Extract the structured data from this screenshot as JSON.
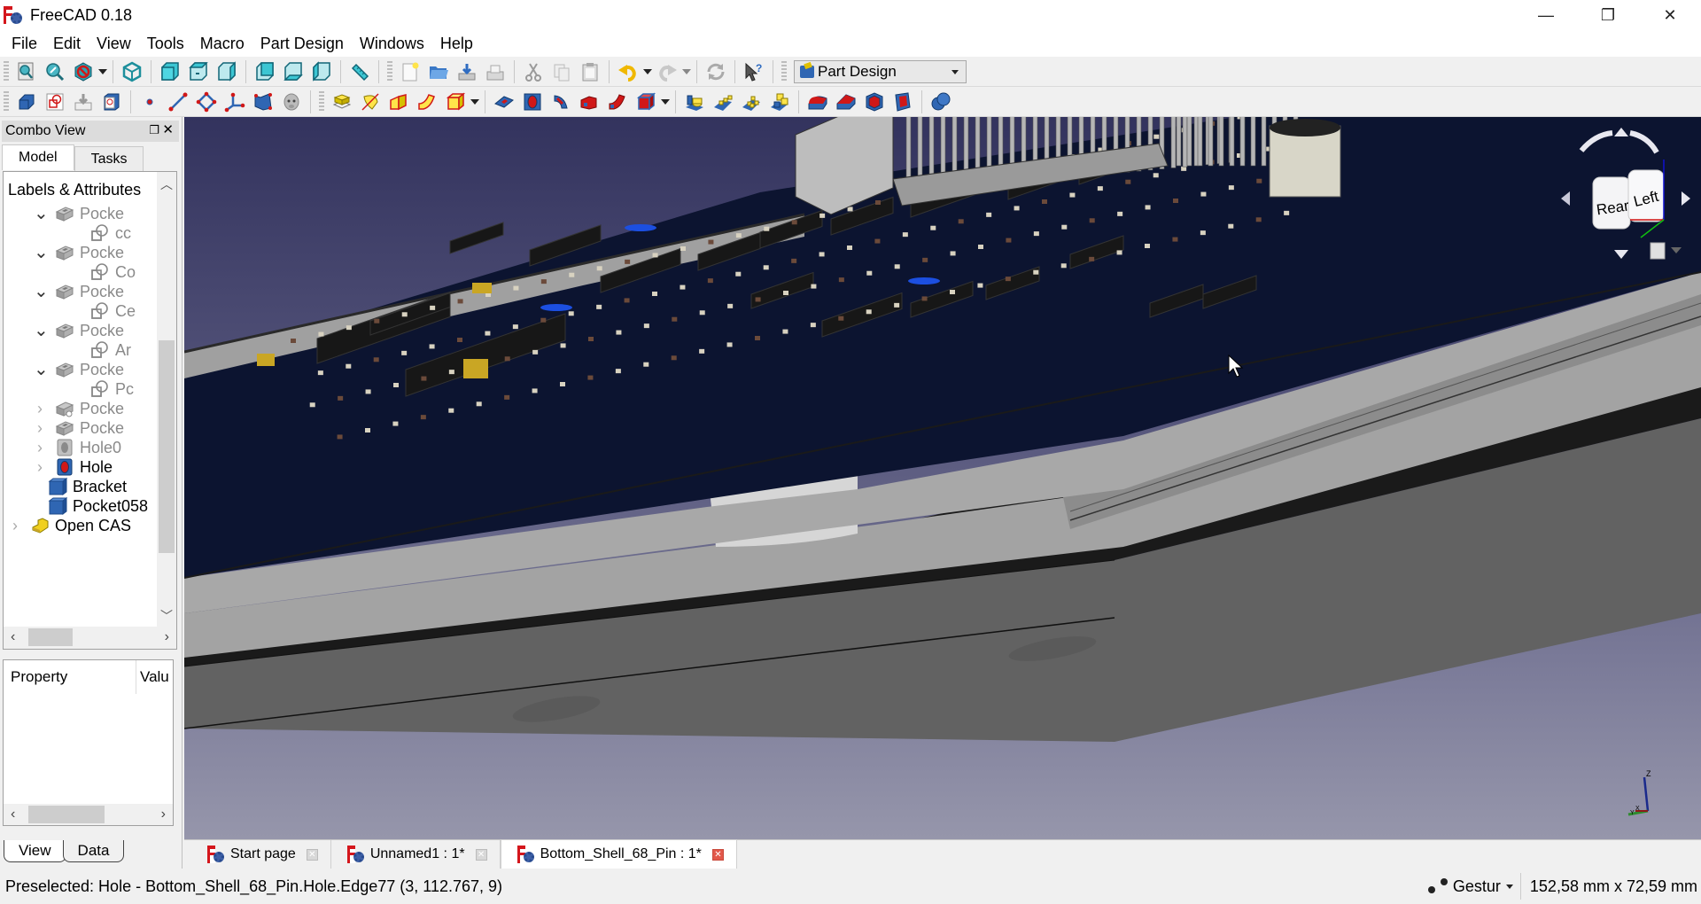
{
  "window": {
    "title": "FreeCAD 0.18",
    "controls": {
      "minimize": "—",
      "restore": "❐",
      "close": "✕"
    }
  },
  "menu": [
    "File",
    "Edit",
    "View",
    "Tools",
    "Macro",
    "Part Design",
    "Windows",
    "Help"
  ],
  "toolbar": {
    "row1": [
      {
        "name": "fit-all-icon",
        "group": "view"
      },
      {
        "name": "fit-selection-icon",
        "group": "view"
      },
      {
        "name": "draw-style-icon",
        "group": "view",
        "dropdown": true
      },
      {
        "name": "isometric-view-icon",
        "group": "std-views"
      },
      {
        "name": "front-view-icon",
        "group": "std-views"
      },
      {
        "name": "top-view-icon",
        "group": "std-views"
      },
      {
        "name": "right-view-icon",
        "group": "std-views"
      },
      {
        "name": "rear-view-icon",
        "group": "std-views2"
      },
      {
        "name": "bottom-view-icon",
        "group": "std-views2"
      },
      {
        "name": "left-view-icon",
        "group": "std-views2"
      },
      {
        "name": "measure-distance-icon",
        "group": "measure"
      },
      {
        "name": "new-document-icon",
        "group": "file"
      },
      {
        "name": "open-document-icon",
        "group": "file"
      },
      {
        "name": "save-document-icon",
        "group": "file"
      },
      {
        "name": "print-icon",
        "group": "file"
      },
      {
        "name": "cut-icon",
        "group": "edit"
      },
      {
        "name": "copy-icon",
        "group": "edit"
      },
      {
        "name": "paste-icon",
        "group": "edit"
      },
      {
        "name": "undo-icon",
        "group": "edit",
        "dropdown": true
      },
      {
        "name": "redo-icon",
        "group": "edit",
        "dropdown": true
      },
      {
        "name": "refresh-icon",
        "group": "edit"
      },
      {
        "name": "whats-this-icon",
        "group": "help"
      }
    ],
    "workbench": {
      "selected": "Part Design"
    },
    "row2": [
      "create-body-icon",
      "create-sketch-icon",
      "validate-sketch-icon",
      "shape-binder-icon",
      "datum-point-icon",
      "datum-line-icon",
      "datum-plane-icon",
      "local-coordinate-system-icon",
      "subshape-binder-icon",
      "clone-icon",
      "pad-icon",
      "revolution-icon",
      "additive-loft-icon",
      "additive-pipe-icon",
      "additive-primitive-icon",
      "pocket-icon",
      "hole-icon",
      "groove-icon",
      "subtractive-loft-icon",
      "subtractive-pipe-icon",
      "subtractive-primitive-icon",
      "mirrored-icon",
      "linear-pattern-icon",
      "polar-pattern-icon",
      "multi-transform-icon",
      "fillet-icon",
      "chamfer-icon",
      "draft-icon",
      "thickness-icon",
      "boolean-icon"
    ]
  },
  "combo_view": {
    "title": "Combo View",
    "tabs": [
      "Model",
      "Tasks"
    ],
    "active_tab": "Model",
    "tree_header": "Labels & Attributes",
    "tree": [
      {
        "label": "Pocke",
        "indent": 2,
        "expander": "down",
        "icon": "pocket-gray",
        "dim": true
      },
      {
        "label": "cc",
        "indent": 3,
        "icon": "sketch-gray",
        "dim": true
      },
      {
        "label": "Pocke",
        "indent": 2,
        "expander": "down",
        "icon": "pocket-gray",
        "dim": true
      },
      {
        "label": "Co",
        "indent": 3,
        "icon": "sketch-gray",
        "dim": true
      },
      {
        "label": "Pocke",
        "indent": 2,
        "expander": "down",
        "icon": "pocket-gray",
        "dim": true
      },
      {
        "label": "Ce",
        "indent": 3,
        "icon": "sketch-gray",
        "dim": true
      },
      {
        "label": "Pocke",
        "indent": 2,
        "expander": "down",
        "icon": "pocket-gray",
        "dim": true
      },
      {
        "label": "Ar",
        "indent": 3,
        "icon": "sketch-gray",
        "dim": true
      },
      {
        "label": "Pocke",
        "indent": 2,
        "expander": "down",
        "icon": "pocket-gray",
        "dim": true
      },
      {
        "label": "Pc",
        "indent": 3,
        "icon": "sketch-gray",
        "dim": true
      },
      {
        "label": "Pocke",
        "indent": 2,
        "expander": "right",
        "icon": "pocket-gray-link",
        "dim": true
      },
      {
        "label": "Pocke",
        "indent": 2,
        "expander": "right",
        "icon": "pocket-gray",
        "dim": true
      },
      {
        "label": "Hole0",
        "indent": 2,
        "expander": "right",
        "icon": "hole-gray",
        "dim": true
      },
      {
        "label": "Hole",
        "indent": 2,
        "expander": "right",
        "icon": "hole-color",
        "dim": false
      },
      {
        "label": "Bracket",
        "indent": 1,
        "icon": "solid-blue",
        "dim": false
      },
      {
        "label": "Pocket058",
        "indent": 1,
        "icon": "solid-blue",
        "dim": false
      },
      {
        "label": "Open CAS",
        "indent": 0,
        "expander": "right",
        "icon": "part-yellow",
        "dim": false
      }
    ],
    "property_columns": [
      "Property",
      "Valu"
    ],
    "bottom_tabs": [
      "View",
      "Data"
    ],
    "active_bottom_tab": "View"
  },
  "viewport": {
    "navcube": {
      "faces": [
        "Rear",
        "Left"
      ]
    },
    "axis_labels": {
      "x": "X",
      "y": "Y",
      "z": "Z"
    },
    "colors": {
      "bg_top": "#33335e",
      "bg_bottom": "#9696ab",
      "pcb": "#0c1430",
      "shell": "#9c9c9c",
      "shell_dark": "#1a1a1a"
    }
  },
  "document_tabs": [
    {
      "label": "Start page",
      "active": false
    },
    {
      "label": "Unnamed1 : 1*",
      "active": false
    },
    {
      "label": "Bottom_Shell_68_Pin : 1*",
      "active": true
    }
  ],
  "status": {
    "message": "Preselected: Hole - Bottom_Shell_68_Pin.Hole.Edge77 (3, 112.767, 9)",
    "navigation_style": "Gestur",
    "dimensions": "152,58 mm x 72,59 mm"
  }
}
